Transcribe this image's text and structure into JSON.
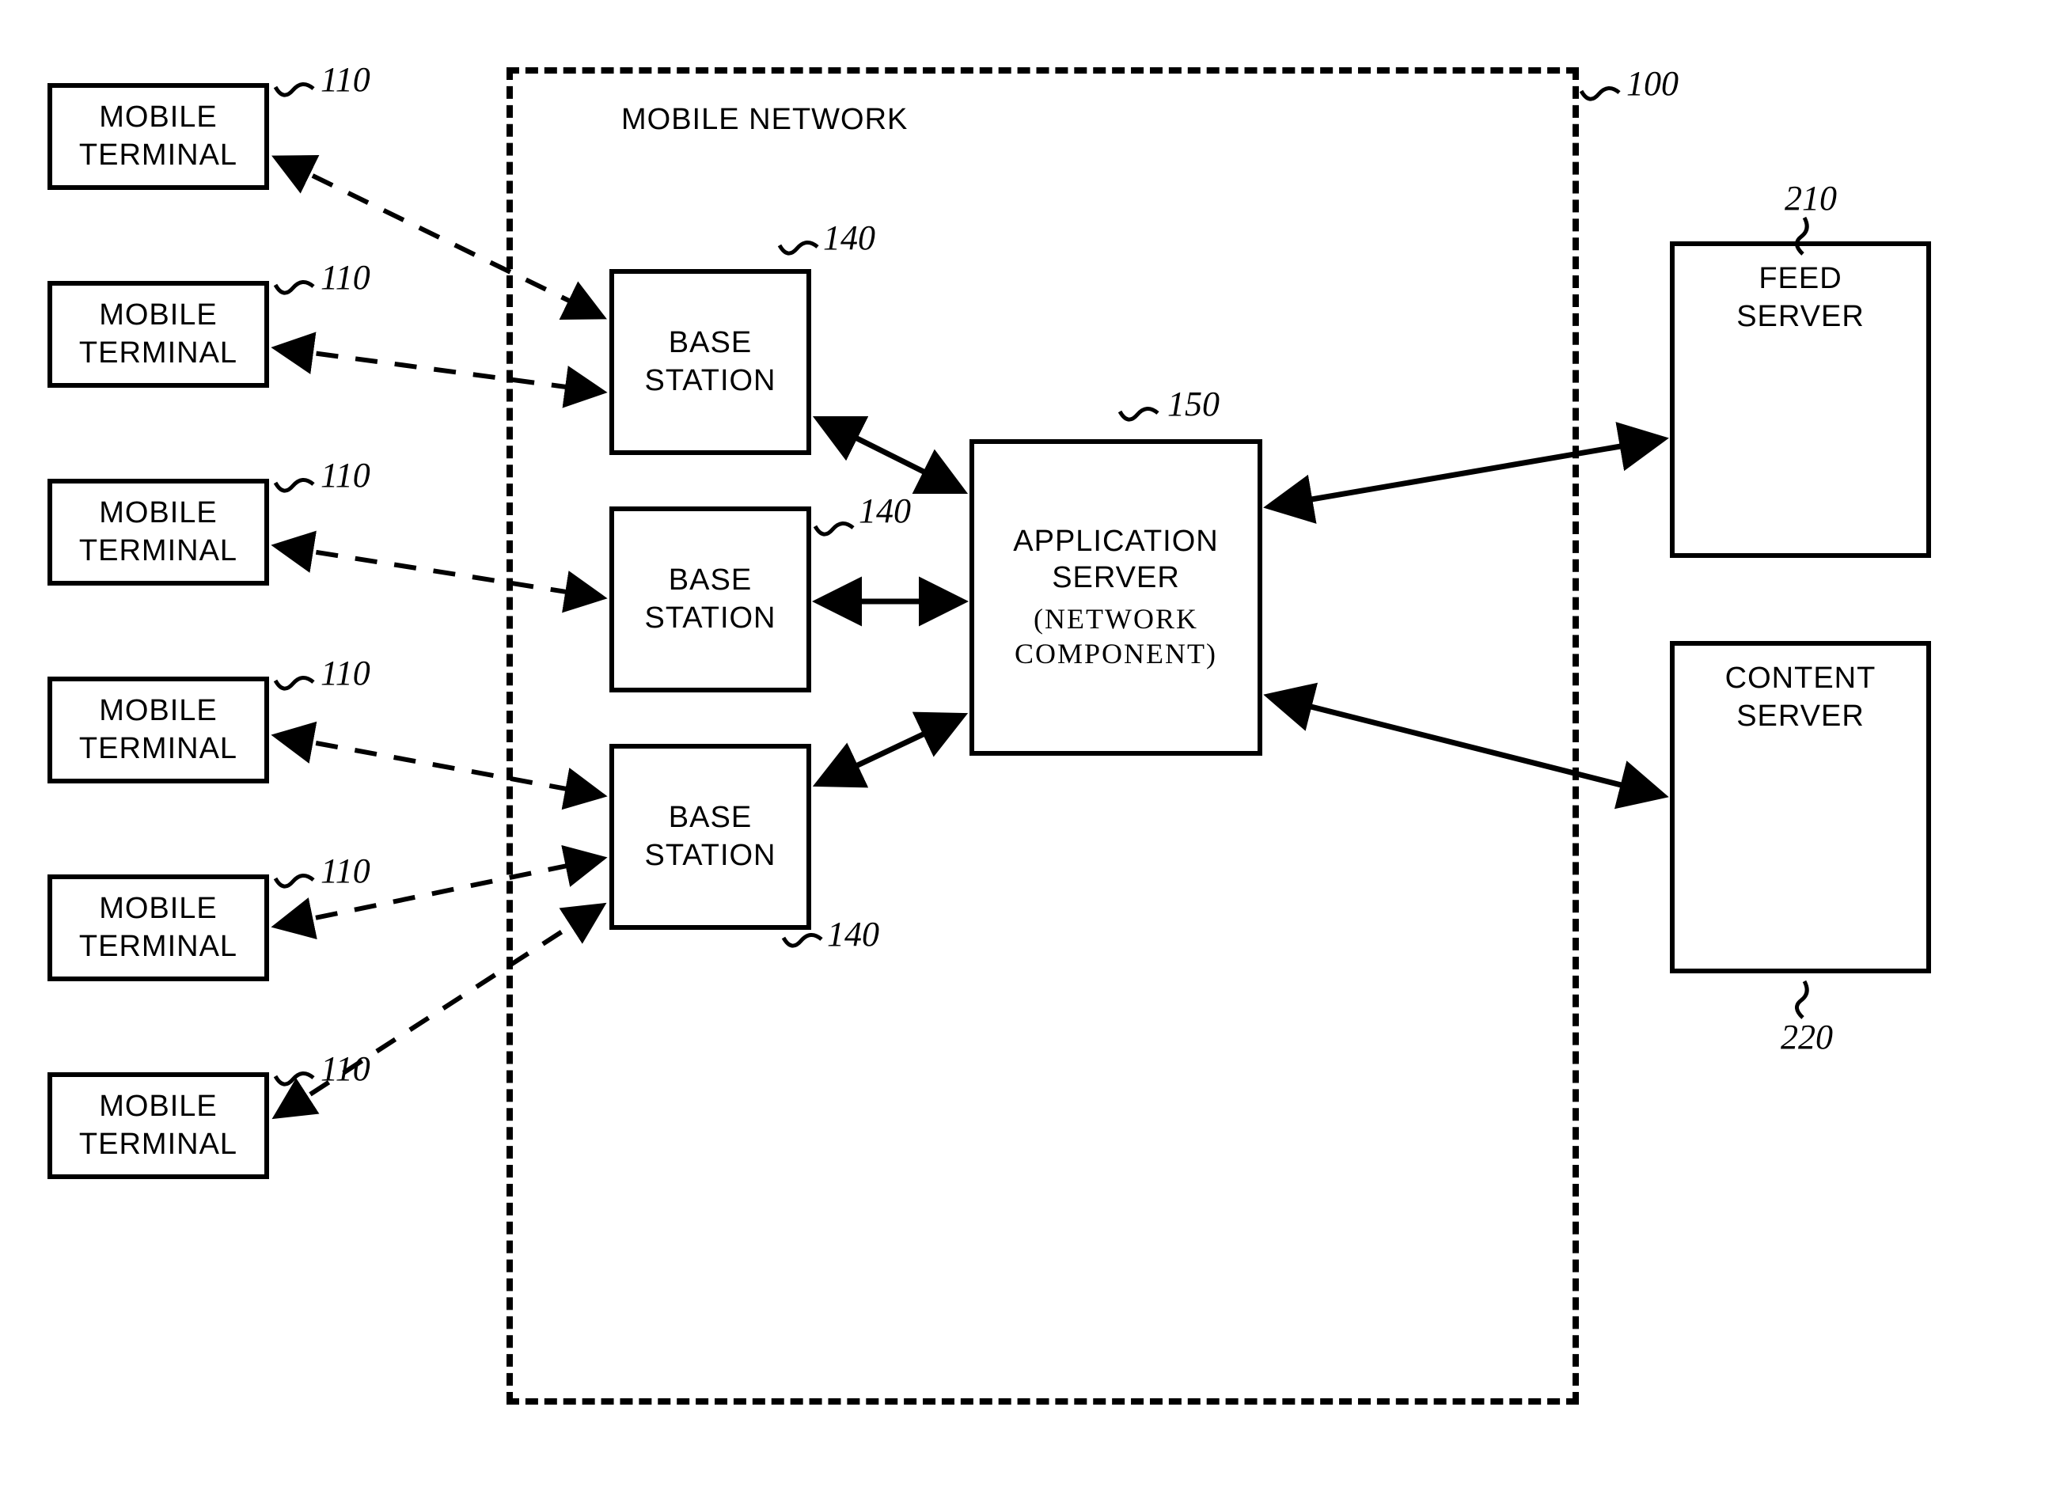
{
  "network": {
    "title": "MOBILE NETWORK",
    "ref": "100"
  },
  "mobile_terminals": [
    {
      "label": "MOBILE\nTERMINAL",
      "ref": "110"
    },
    {
      "label": "MOBILE\nTERMINAL",
      "ref": "110"
    },
    {
      "label": "MOBILE\nTERMINAL",
      "ref": "110"
    },
    {
      "label": "MOBILE\nTERMINAL",
      "ref": "110"
    },
    {
      "label": "MOBILE\nTERMINAL",
      "ref": "110"
    },
    {
      "label": "MOBILE\nTERMINAL",
      "ref": "110"
    }
  ],
  "base_stations": [
    {
      "label": "BASE\nSTATION",
      "ref": "140"
    },
    {
      "label": "BASE\nSTATION",
      "ref": "140"
    },
    {
      "label": "BASE\nSTATION",
      "ref": "140"
    }
  ],
  "app_server": {
    "label": "APPLICATION\nSERVER",
    "subtitle": "(NETWORK\nCOMPONENT)",
    "ref": "150"
  },
  "feed_server": {
    "label": "FEED\nSERVER",
    "ref": "210"
  },
  "content_server": {
    "label": "CONTENT\nSERVER",
    "ref": "220"
  }
}
